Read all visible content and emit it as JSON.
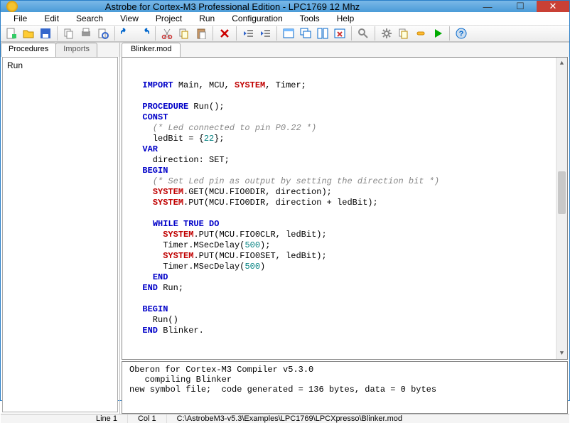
{
  "title": "Astrobe for Cortex-M3 Professional Edition - LPC1769 12 Mhz",
  "menu": [
    "File",
    "Edit",
    "Search",
    "View",
    "Project",
    "Run",
    "Configuration",
    "Tools",
    "Help"
  ],
  "left": {
    "tabs": [
      "Procedures",
      "Imports"
    ],
    "active_tab": 0,
    "items": [
      "Run"
    ]
  },
  "file_tab": "Blinker.mod",
  "code": [
    {
      "indent": 1,
      "segs": [
        {
          "t": "IMPORT",
          "c": "kw"
        },
        {
          "t": " Main, MCU, "
        },
        {
          "t": "SYSTEM",
          "c": "sys"
        },
        {
          "t": ", Timer;"
        }
      ]
    },
    {
      "indent": 0,
      "segs": [
        {
          "t": ""
        }
      ]
    },
    {
      "indent": 1,
      "segs": [
        {
          "t": "PROCEDURE",
          "c": "kw"
        },
        {
          "t": " Run();"
        }
      ]
    },
    {
      "indent": 1,
      "segs": [
        {
          "t": "CONST",
          "c": "kw"
        }
      ]
    },
    {
      "indent": 2,
      "segs": [
        {
          "t": "(* Led connected to pin P0.22 *)",
          "c": "cm"
        }
      ]
    },
    {
      "indent": 2,
      "segs": [
        {
          "t": "ledBit = {"
        },
        {
          "t": "22",
          "c": "num"
        },
        {
          "t": "};"
        }
      ]
    },
    {
      "indent": 1,
      "segs": [
        {
          "t": "VAR",
          "c": "kw"
        }
      ]
    },
    {
      "indent": 2,
      "segs": [
        {
          "t": "direction: SET;"
        }
      ]
    },
    {
      "indent": 1,
      "segs": [
        {
          "t": "BEGIN",
          "c": "kw"
        }
      ]
    },
    {
      "indent": 2,
      "segs": [
        {
          "t": "(* Set Led pin as output by setting the direction bit *)",
          "c": "cm"
        }
      ]
    },
    {
      "indent": 2,
      "segs": [
        {
          "t": "SYSTEM",
          "c": "sys"
        },
        {
          "t": ".GET(MCU.FIO0DIR, direction);"
        }
      ]
    },
    {
      "indent": 2,
      "segs": [
        {
          "t": "SYSTEM",
          "c": "sys"
        },
        {
          "t": ".PUT(MCU.FIO0DIR, direction + ledBit);"
        }
      ]
    },
    {
      "indent": 0,
      "segs": [
        {
          "t": ""
        }
      ]
    },
    {
      "indent": 2,
      "segs": [
        {
          "t": "WHILE TRUE DO",
          "c": "kw"
        }
      ]
    },
    {
      "indent": 3,
      "segs": [
        {
          "t": "SYSTEM",
          "c": "sys"
        },
        {
          "t": ".PUT(MCU.FIO0CLR, ledBit);"
        }
      ]
    },
    {
      "indent": 3,
      "segs": [
        {
          "t": "Timer.MSecDelay("
        },
        {
          "t": "500",
          "c": "num"
        },
        {
          "t": ");"
        }
      ]
    },
    {
      "indent": 3,
      "segs": [
        {
          "t": "SYSTEM",
          "c": "sys"
        },
        {
          "t": ".PUT(MCU.FIO0SET, ledBit);"
        }
      ]
    },
    {
      "indent": 3,
      "segs": [
        {
          "t": "Timer.MSecDelay("
        },
        {
          "t": "500",
          "c": "num"
        },
        {
          "t": ")"
        }
      ]
    },
    {
      "indent": 2,
      "segs": [
        {
          "t": "END",
          "c": "kw"
        }
      ]
    },
    {
      "indent": 1,
      "segs": [
        {
          "t": "END",
          "c": "kw"
        },
        {
          "t": " Run;"
        }
      ]
    },
    {
      "indent": 0,
      "segs": [
        {
          "t": ""
        }
      ]
    },
    {
      "indent": 1,
      "segs": [
        {
          "t": "BEGIN",
          "c": "kw"
        }
      ]
    },
    {
      "indent": 2,
      "segs": [
        {
          "t": "Run()"
        }
      ]
    },
    {
      "indent": 1,
      "segs": [
        {
          "t": "END",
          "c": "kw"
        },
        {
          "t": " Blinker."
        }
      ]
    }
  ],
  "output": [
    "Oberon for Cortex-M3 Compiler v5.3.0",
    "   compiling Blinker",
    "new symbol file;  code generated = 136 bytes, data = 0 bytes"
  ],
  "status": {
    "line": "Line 1",
    "col": "Col 1",
    "path": "C:\\AstrobeM3-v5.3\\Examples\\LPC1769\\LPCXpresso\\Blinker.mod"
  },
  "toolbar_icons": [
    "new-file-icon",
    "open-folder-icon",
    "save-icon",
    "sep",
    "copy-page-icon",
    "print-icon",
    "print-preview-icon",
    "sep",
    "undo-icon",
    "redo-icon",
    "sep",
    "cut-icon",
    "copy-icon",
    "paste-icon",
    "sep",
    "delete-icon",
    "sep",
    "outdent-icon",
    "indent-icon",
    "sep",
    "window-icon",
    "cascade-icon",
    "tile-icon",
    "close-window-icon",
    "sep",
    "find-icon",
    "sep",
    "gear-icon",
    "build-icon",
    "link-icon",
    "run-icon",
    "sep",
    "help-icon"
  ]
}
